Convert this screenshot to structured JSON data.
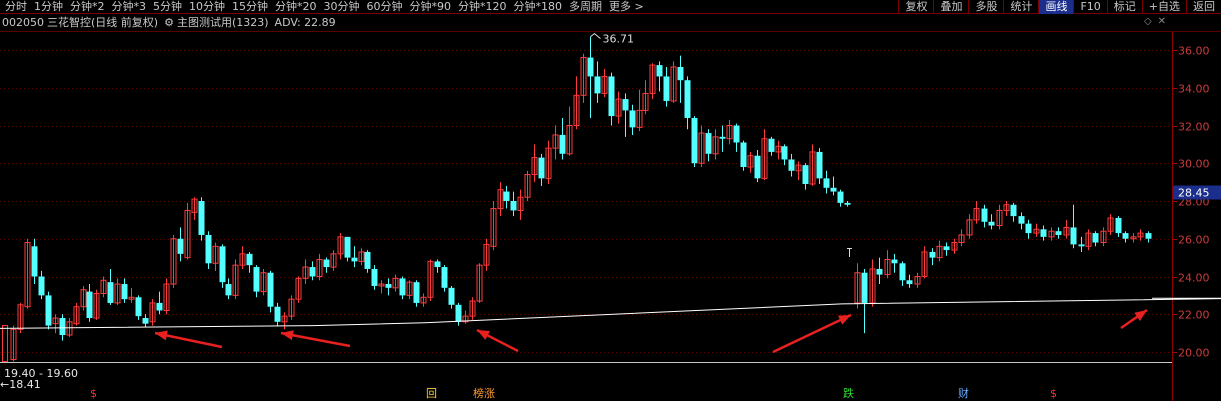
{
  "toolbar": {
    "periods": [
      "分时",
      "1分钟",
      "分钟*2",
      "分钟*3",
      "5分钟",
      "10分钟",
      "15分钟",
      "分钟*20",
      "30分钟",
      "60分钟",
      "分钟*90",
      "分钟*120",
      "分钟*180",
      "多周期",
      "更多 >"
    ],
    "right_buttons": [
      "复权",
      "叠加",
      "多股",
      "统计",
      "画线",
      "F10",
      "标记",
      "+自选",
      "返回"
    ],
    "active_right": "画线"
  },
  "info": {
    "code": "002050",
    "name": "三花智控(日线 前复权)",
    "gear_icon": "gear-icon",
    "indicator": "主图测试用(1323)",
    "adv": "ADV: 22.89",
    "corner_icons": [
      "dropdown-icon",
      "close-icon"
    ]
  },
  "range_label": "19.40 - 19.60",
  "low_label": "←18.41",
  "marks": [
    {
      "text": "$",
      "color": "#ff3030"
    },
    {
      "text": "回",
      "color": "#ffcc33"
    },
    {
      "text": "榜涨",
      "color": "#ff9933"
    },
    {
      "text": "跌",
      "color": "#33dd33"
    },
    {
      "text": "财",
      "color": "#66aaff"
    },
    {
      "text": "$",
      "color": "#ff3030"
    }
  ],
  "chart_data": {
    "type": "candlestick",
    "y_ticks": [
      "36.00",
      "34.00",
      "32.00",
      "30.00",
      "28.00",
      "26.00",
      "24.00",
      "22.00",
      "20.00"
    ],
    "ylim": [
      19.5,
      37.5
    ],
    "current_price": "28.45",
    "high_annotation": "36.71",
    "low_annotation": "18.41",
    "colors": {
      "up": "#ff3c3c",
      "down": "#54ffff",
      "grid": "#5a0000",
      "support_line": "#ffffff",
      "arrow": "#e82020"
    },
    "candles": [
      [
        19.6,
        21.2,
        19.5,
        21.4
      ],
      [
        21.2,
        22.5,
        21.0,
        22.6
      ],
      [
        22.4,
        25.8,
        22.3,
        26.0
      ],
      [
        25.6,
        24.0,
        23.6,
        26.0
      ],
      [
        24.0,
        23.0,
        22.8,
        24.3
      ],
      [
        23.0,
        21.4,
        21.2,
        23.2
      ],
      [
        21.5,
        21.8,
        21.0,
        22.0
      ],
      [
        21.8,
        20.9,
        20.6,
        22.0
      ],
      [
        20.9,
        21.6,
        20.8,
        21.8
      ],
      [
        21.5,
        22.4,
        21.4,
        22.6
      ],
      [
        22.4,
        23.3,
        22.2,
        23.5
      ],
      [
        23.2,
        21.8,
        21.6,
        23.6
      ],
      [
        21.8,
        23.1,
        21.7,
        23.3
      ],
      [
        23.1,
        23.8,
        22.9,
        24.0
      ],
      [
        23.7,
        22.6,
        22.5,
        24.4
      ],
      [
        22.6,
        23.6,
        22.5,
        23.9
      ],
      [
        23.6,
        22.8,
        22.6,
        23.9
      ],
      [
        22.8,
        22.9,
        22.6,
        23.4
      ],
      [
        22.9,
        21.9,
        21.7,
        23.0
      ],
      [
        21.8,
        21.5,
        21.3,
        22.0
      ],
      [
        21.6,
        22.6,
        21.4,
        22.8
      ],
      [
        22.6,
        22.2,
        22.0,
        23.2
      ],
      [
        22.2,
        23.6,
        22.0,
        23.9
      ],
      [
        23.6,
        26.0,
        23.4,
        26.2
      ],
      [
        26.0,
        25.2,
        24.8,
        26.6
      ],
      [
        25.0,
        27.5,
        24.9,
        27.9
      ],
      [
        27.4,
        28.1,
        27.0,
        28.2
      ],
      [
        28.0,
        26.2,
        25.9,
        28.2
      ],
      [
        26.2,
        24.7,
        24.4,
        26.4
      ],
      [
        24.7,
        25.6,
        24.3,
        25.8
      ],
      [
        25.6,
        23.7,
        23.4,
        25.7
      ],
      [
        23.6,
        23.0,
        22.8,
        23.9
      ],
      [
        23.0,
        24.6,
        22.8,
        24.9
      ],
      [
        24.6,
        25.2,
        24.4,
        25.6
      ],
      [
        25.2,
        24.6,
        24.2,
        25.3
      ],
      [
        24.5,
        23.2,
        22.9,
        24.6
      ],
      [
        23.2,
        24.2,
        23.0,
        24.4
      ],
      [
        24.2,
        22.4,
        22.1,
        24.3
      ],
      [
        22.4,
        21.6,
        21.4,
        22.6
      ],
      [
        21.6,
        21.9,
        21.2,
        22.1
      ],
      [
        21.9,
        22.8,
        21.7,
        23.0
      ],
      [
        22.8,
        23.9,
        22.6,
        24.0
      ],
      [
        23.9,
        24.5,
        23.6,
        24.9
      ],
      [
        24.5,
        24.0,
        23.8,
        24.8
      ],
      [
        24.0,
        24.9,
        23.8,
        25.2
      ],
      [
        24.9,
        24.5,
        24.2,
        25.0
      ],
      [
        24.5,
        25.2,
        24.3,
        25.4
      ],
      [
        25.2,
        26.1,
        24.9,
        26.3
      ],
      [
        26.1,
        25.0,
        24.8,
        26.1
      ],
      [
        25.0,
        24.8,
        24.5,
        25.6
      ],
      [
        24.8,
        25.3,
        24.6,
        25.5
      ],
      [
        25.3,
        24.4,
        24.2,
        25.4
      ],
      [
        24.4,
        23.5,
        23.3,
        24.6
      ],
      [
        23.5,
        23.6,
        23.1,
        23.8
      ],
      [
        23.6,
        23.4,
        23.0,
        23.9
      ],
      [
        23.4,
        23.9,
        23.2,
        24.1
      ],
      [
        23.9,
        23.0,
        22.8,
        24.0
      ],
      [
        23.0,
        23.7,
        22.8,
        23.8
      ],
      [
        23.7,
        22.6,
        22.4,
        23.8
      ],
      [
        22.6,
        22.9,
        22.4,
        23.1
      ],
      [
        22.9,
        24.8,
        22.7,
        24.9
      ],
      [
        24.8,
        24.5,
        24.2,
        24.9
      ],
      [
        24.5,
        23.4,
        23.2,
        24.6
      ],
      [
        23.4,
        22.5,
        22.3,
        23.5
      ],
      [
        22.5,
        21.6,
        21.4,
        22.6
      ],
      [
        21.6,
        21.9,
        21.5,
        22.2
      ],
      [
        21.9,
        22.7,
        21.7,
        22.9
      ],
      [
        22.7,
        24.6,
        22.6,
        24.7
      ],
      [
        24.6,
        25.7,
        24.3,
        26.0
      ],
      [
        25.6,
        27.6,
        25.4,
        28.0
      ],
      [
        27.6,
        28.6,
        27.2,
        29.0
      ],
      [
        28.5,
        28.0,
        27.6,
        28.8
      ],
      [
        28.0,
        27.5,
        27.2,
        28.5
      ],
      [
        27.5,
        28.2,
        27.0,
        28.6
      ],
      [
        28.2,
        29.4,
        28.0,
        29.6
      ],
      [
        29.4,
        30.3,
        29.0,
        31.0
      ],
      [
        30.3,
        29.2,
        28.8,
        30.5
      ],
      [
        29.2,
        30.8,
        28.9,
        31.2
      ],
      [
        30.8,
        31.5,
        30.2,
        32.0
      ],
      [
        31.5,
        30.5,
        30.2,
        32.4
      ],
      [
        30.5,
        32.0,
        30.4,
        33.0
      ],
      [
        32.0,
        33.6,
        31.8,
        34.6
      ],
      [
        33.6,
        35.6,
        33.2,
        35.8
      ],
      [
        35.6,
        34.6,
        32.4,
        36.71
      ],
      [
        34.6,
        33.7,
        33.2,
        35.4
      ],
      [
        33.7,
        34.6,
        33.5,
        35.0
      ],
      [
        34.6,
        32.5,
        32.0,
        34.8
      ],
      [
        32.5,
        33.4,
        32.1,
        33.8
      ],
      [
        33.4,
        32.8,
        31.4,
        33.7
      ],
      [
        32.8,
        31.9,
        31.5,
        33.1
      ],
      [
        31.9,
        32.8,
        31.7,
        33.9
      ],
      [
        32.8,
        33.7,
        32.6,
        34.4
      ],
      [
        33.7,
        35.2,
        33.4,
        35.3
      ],
      [
        35.2,
        34.6,
        33.8,
        35.4
      ],
      [
        34.6,
        33.3,
        33.0,
        35.1
      ],
      [
        33.3,
        35.1,
        33.2,
        35.4
      ],
      [
        35.1,
        34.4,
        33.2,
        35.7
      ],
      [
        34.4,
        32.4,
        31.8,
        34.6
      ],
      [
        32.4,
        30.0,
        29.8,
        32.5
      ],
      [
        30.0,
        31.6,
        29.8,
        32.0
      ],
      [
        31.6,
        30.5,
        30.1,
        31.8
      ],
      [
        30.5,
        31.4,
        30.2,
        31.8
      ],
      [
        31.4,
        31.3,
        30.6,
        32.0
      ],
      [
        31.3,
        32.0,
        31.0,
        32.3
      ],
      [
        32.0,
        31.1,
        30.6,
        32.1
      ],
      [
        31.1,
        29.8,
        29.6,
        31.2
      ],
      [
        29.8,
        30.4,
        29.5,
        30.6
      ],
      [
        30.4,
        29.2,
        29.0,
        30.7
      ],
      [
        29.2,
        31.3,
        29.1,
        31.8
      ],
      [
        31.3,
        30.6,
        30.4,
        31.4
      ],
      [
        30.6,
        30.9,
        30.2,
        31.2
      ],
      [
        30.9,
        30.2,
        29.9,
        31.0
      ],
      [
        30.2,
        29.6,
        29.3,
        30.5
      ],
      [
        29.6,
        29.9,
        29.1,
        30.1
      ],
      [
        29.9,
        28.9,
        28.6,
        30.0
      ],
      [
        28.9,
        30.6,
        28.8,
        31.0
      ],
      [
        30.6,
        29.2,
        28.9,
        30.8
      ],
      [
        29.2,
        28.7,
        28.4,
        29.6
      ],
      [
        28.7,
        28.5,
        28.3,
        29.3
      ],
      [
        28.5,
        27.9,
        27.7,
        28.6
      ],
      [
        27.9,
        27.8,
        27.7,
        28.0
      ],
      [
        22.6,
        24.2,
        22.3,
        24.7
      ],
      [
        24.2,
        22.6,
        21.0,
        24.4
      ],
      [
        22.6,
        24.4,
        22.4,
        24.9
      ],
      [
        24.4,
        24.1,
        23.6,
        25.0
      ],
      [
        24.1,
        24.9,
        23.9,
        25.4
      ],
      [
        24.9,
        24.7,
        24.2,
        25.2
      ],
      [
        24.7,
        23.8,
        23.5,
        24.8
      ],
      [
        23.8,
        23.6,
        23.4,
        24.1
      ],
      [
        23.6,
        24.0,
        23.4,
        24.2
      ],
      [
        24.0,
        25.3,
        23.9,
        25.6
      ],
      [
        25.3,
        25.0,
        24.6,
        25.5
      ],
      [
        25.0,
        25.6,
        24.8,
        25.9
      ],
      [
        25.6,
        25.4,
        25.1,
        25.8
      ],
      [
        25.4,
        25.8,
        25.2,
        26.0
      ],
      [
        25.8,
        26.2,
        25.6,
        26.5
      ],
      [
        26.2,
        27.0,
        26.0,
        27.3
      ],
      [
        27.0,
        27.6,
        26.8,
        28.0
      ],
      [
        27.6,
        26.9,
        26.6,
        27.8
      ],
      [
        26.9,
        26.7,
        26.5,
        27.3
      ],
      [
        26.7,
        27.5,
        26.5,
        27.8
      ],
      [
        27.5,
        27.8,
        27.2,
        28.0
      ],
      [
        27.8,
        27.2,
        26.9,
        27.9
      ],
      [
        27.2,
        26.8,
        26.5,
        27.4
      ],
      [
        26.8,
        26.3,
        26.0,
        27.0
      ],
      [
        26.3,
        26.5,
        26.1,
        26.8
      ],
      [
        26.5,
        26.1,
        25.9,
        26.7
      ],
      [
        26.1,
        26.4,
        25.9,
        26.6
      ],
      [
        26.4,
        26.2,
        26.0,
        26.6
      ],
      [
        26.2,
        26.6,
        26.0,
        27.0
      ],
      [
        26.6,
        25.7,
        25.5,
        27.8
      ],
      [
        25.7,
        25.6,
        25.3,
        26.1
      ],
      [
        25.6,
        26.3,
        25.4,
        26.5
      ],
      [
        26.3,
        25.8,
        25.6,
        26.4
      ],
      [
        25.8,
        26.4,
        25.6,
        26.6
      ],
      [
        26.4,
        27.1,
        26.2,
        27.3
      ],
      [
        27.1,
        26.3,
        26.1,
        27.2
      ],
      [
        26.3,
        26.0,
        25.8,
        26.4
      ],
      [
        26.0,
        26.1,
        25.8,
        26.3
      ],
      [
        26.1,
        26.3,
        25.9,
        26.5
      ],
      [
        26.3,
        26.0,
        25.8,
        26.4
      ]
    ],
    "support_line": [
      [
        0,
        21.25
      ],
      [
        44,
        21.4
      ],
      [
        60,
        21.55
      ],
      [
        120,
        22.55
      ],
      [
        175,
        22.85
      ]
    ]
  }
}
